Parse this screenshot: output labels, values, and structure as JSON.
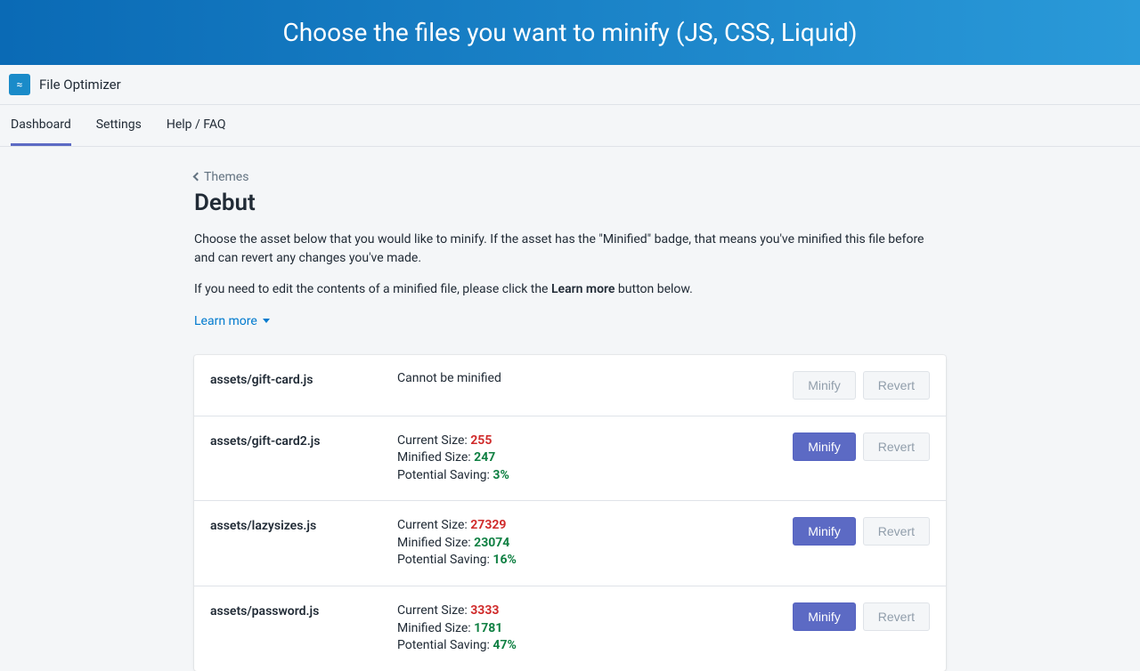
{
  "banner": {
    "title": "Choose the files you want to minify (JS, CSS, Liquid)"
  },
  "app": {
    "name": "File Optimizer"
  },
  "tabs": [
    {
      "label": "Dashboard",
      "active": true
    },
    {
      "label": "Settings",
      "active": false
    },
    {
      "label": "Help / FAQ",
      "active": false
    }
  ],
  "breadcrumb": {
    "label": "Themes"
  },
  "page": {
    "title": "Debut",
    "desc1": "Choose the asset below that you would like to minify. If the asset has the \"Minified\" badge, that means you've minified this file before and can revert any changes you've made.",
    "desc2_pre": "If you need to edit the contents of a minified file, please click the ",
    "desc2_bold": "Learn more",
    "desc2_post": " button below.",
    "learn_more": "Learn more"
  },
  "labels": {
    "current_size": "Current Size:",
    "minified_size": "Minified Size:",
    "potential_saving": "Potential Saving:",
    "cannot": "Cannot be minified",
    "minify": "Minify",
    "revert": "Revert"
  },
  "assets": [
    {
      "name": "assets/gift-card.js",
      "cannot": true
    },
    {
      "name": "assets/gift-card2.js",
      "current": "255",
      "minified": "247",
      "saving": "3%"
    },
    {
      "name": "assets/lazysizes.js",
      "current": "27329",
      "minified": "23074",
      "saving": "16%"
    },
    {
      "name": "assets/password.js",
      "current": "3333",
      "minified": "1781",
      "saving": "47%"
    }
  ]
}
